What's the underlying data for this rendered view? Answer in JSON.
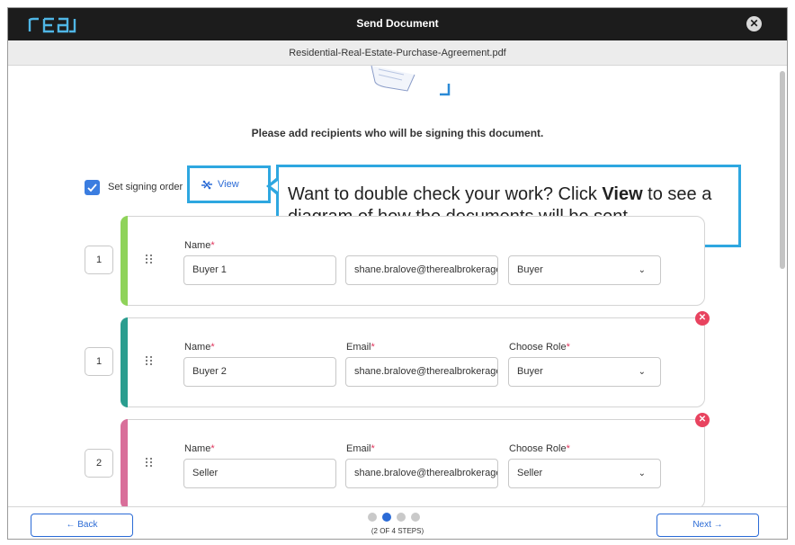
{
  "header": {
    "logo_text": "real",
    "title": "Send Document",
    "close_icon": "close-icon"
  },
  "file": {
    "name": "Residential-Real-Estate-Purchase-Agreement.pdf"
  },
  "main": {
    "prompt": "Please add recipients who will be signing this document.",
    "signing_order": {
      "label": "Set signing order",
      "checked": true
    },
    "view_link": {
      "label": "View",
      "icon": "diagram-icon"
    },
    "tooltip": {
      "before": "Want to double check your work? Click ",
      "bold": "View",
      "after": " to see a diagram of how the documents will be sent."
    },
    "labels": {
      "name": "Name",
      "email": "Email",
      "role": "Choose Role",
      "required_mark": "*"
    },
    "recipients": [
      {
        "order": "1",
        "name": "Buyer 1",
        "email": "shane.bralove@therealbrokerage.com",
        "role": "Buyer",
        "accent": "#8fd35a"
      },
      {
        "order": "1",
        "name": "Buyer 2",
        "email": "shane.bralove@therealbrokerage.com",
        "role": "Buyer",
        "accent": "#2a9d8f"
      },
      {
        "order": "2",
        "name": "Seller",
        "email": "shane.bralove@therealbrokerage.com",
        "role": "Seller",
        "accent": "#d96f9a"
      }
    ]
  },
  "footer": {
    "back_label": "← Back",
    "next_label": "Next →",
    "steps_text": "(2 OF 4 STEPS)",
    "current_step": 2,
    "total_steps": 4
  },
  "colors": {
    "accent": "#2b6bd6",
    "danger": "#e8435f",
    "callout": "#2ea7e0"
  }
}
